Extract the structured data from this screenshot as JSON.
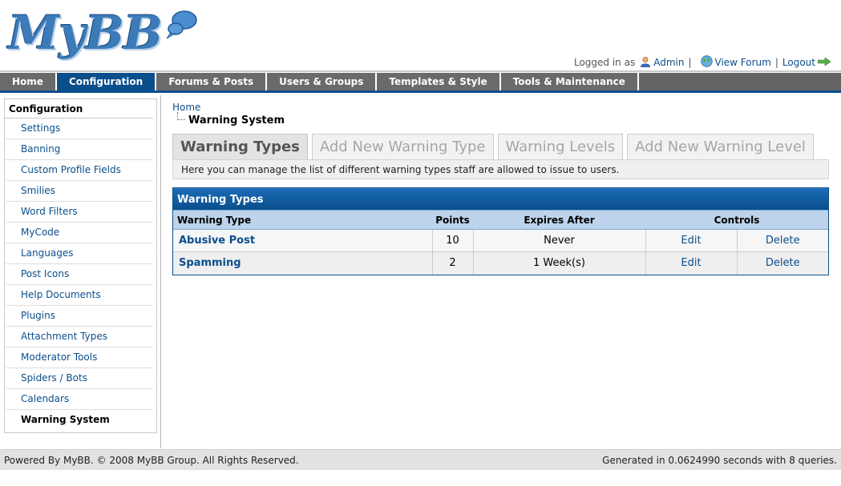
{
  "logo": {
    "text": "MyBB"
  },
  "welcome": {
    "logged_in_as": "Logged in as",
    "user": "Admin",
    "view_forum": "View Forum",
    "logout": "Logout",
    "sep": "|"
  },
  "menu": {
    "tabs": [
      {
        "label": "Home"
      },
      {
        "label": "Configuration"
      },
      {
        "label": "Forums & Posts"
      },
      {
        "label": "Users & Groups"
      },
      {
        "label": "Templates & Style"
      },
      {
        "label": "Tools & Maintenance"
      }
    ],
    "active": "Configuration"
  },
  "sidebar": {
    "title": "Configuration",
    "items": [
      {
        "label": "Settings"
      },
      {
        "label": "Banning"
      },
      {
        "label": "Custom Profile Fields"
      },
      {
        "label": "Smilies"
      },
      {
        "label": "Word Filters"
      },
      {
        "label": "MyCode"
      },
      {
        "label": "Languages"
      },
      {
        "label": "Post Icons"
      },
      {
        "label": "Help Documents"
      },
      {
        "label": "Plugins"
      },
      {
        "label": "Attachment Types"
      },
      {
        "label": "Moderator Tools"
      },
      {
        "label": "Spiders / Bots"
      },
      {
        "label": "Calendars"
      },
      {
        "label": "Warning System"
      }
    ],
    "active": "Warning System"
  },
  "breadcrumb": {
    "home": "Home",
    "current": "Warning System"
  },
  "tabs": [
    {
      "label": "Warning Types"
    },
    {
      "label": "Add New Warning Type"
    },
    {
      "label": "Warning Levels"
    },
    {
      "label": "Add New Warning Level"
    }
  ],
  "tab_description": "Here you can manage the list of different warning types staff are allowed to issue to users.",
  "table": {
    "title": "Warning Types",
    "headers": {
      "type": "Warning Type",
      "points": "Points",
      "expires": "Expires After",
      "controls": "Controls"
    },
    "rows": [
      {
        "name": "Abusive Post",
        "points": "10",
        "expires": "Never",
        "edit": "Edit",
        "delete": "Delete"
      },
      {
        "name": "Spamming",
        "points": "2",
        "expires": "1 Week(s)",
        "edit": "Edit",
        "delete": "Delete"
      }
    ]
  },
  "footer": {
    "left": "Powered By MyBB. © 2008 MyBB Group. All Rights Reserved.",
    "right": "Generated in 0.0624990 seconds with 8 queries."
  },
  "colors": {
    "accent": "#0a4e8b",
    "menu_bg": "#646464",
    "header_row": "#bdd3eb"
  }
}
